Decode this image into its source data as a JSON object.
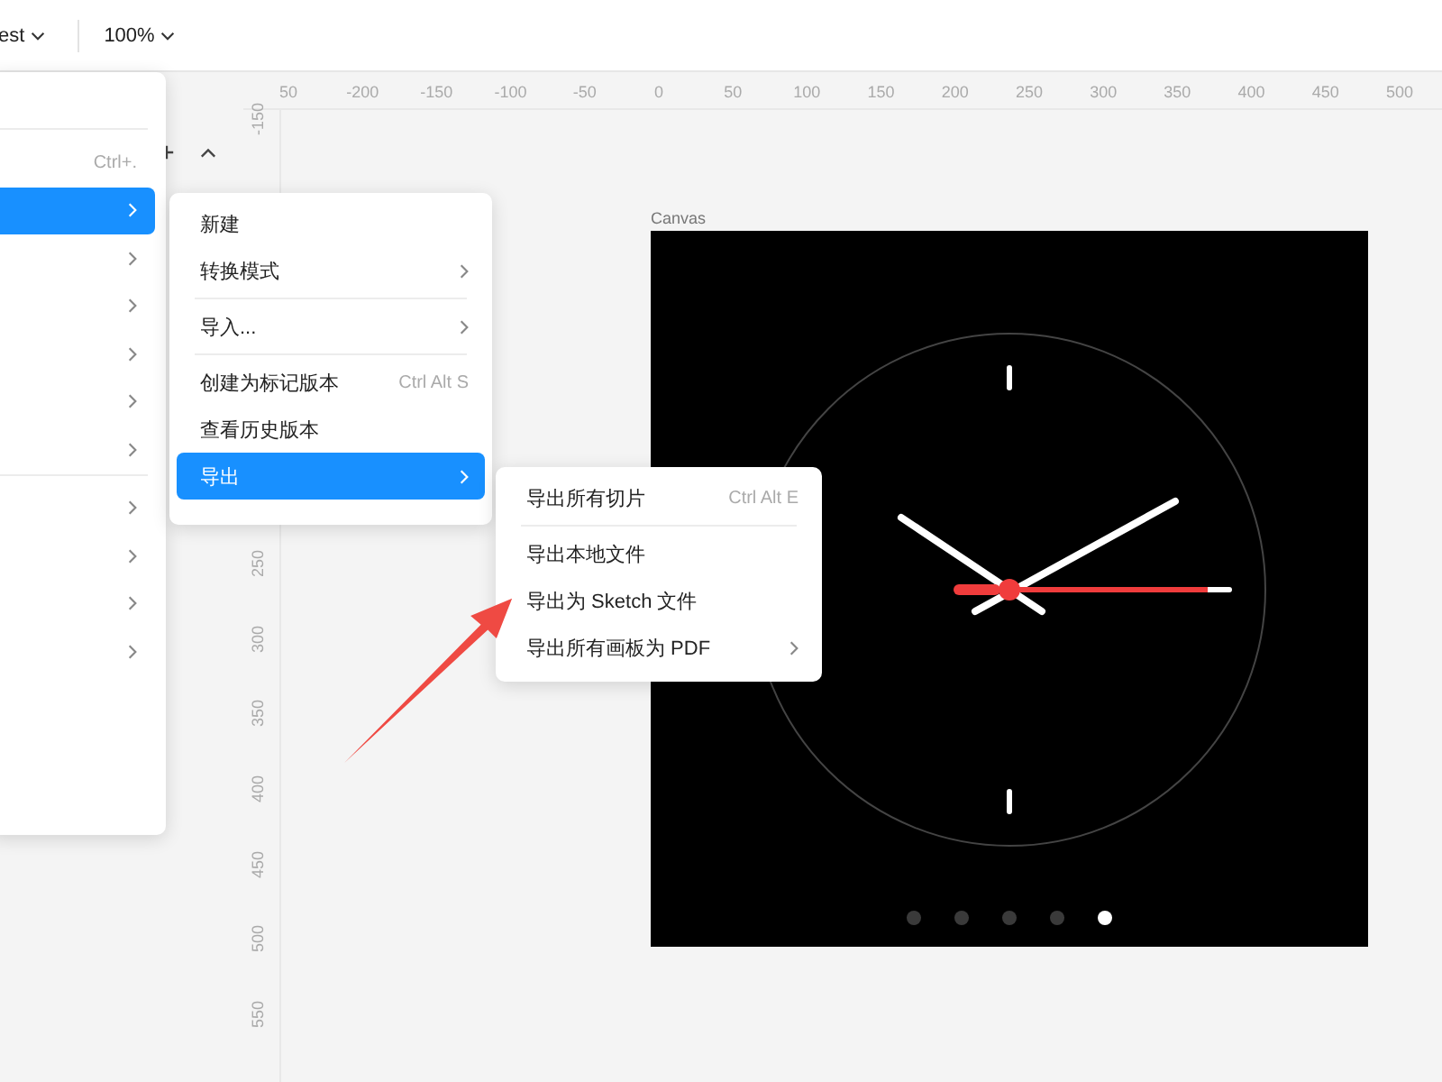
{
  "toolbar": {
    "file_name": "est",
    "zoom": "100%"
  },
  "ruler": {
    "horizontal": [
      "50",
      "-200",
      "-150",
      "-100",
      "-50",
      "0",
      "50",
      "100",
      "150",
      "200",
      "250",
      "300",
      "350",
      "400",
      "450",
      "500"
    ],
    "vertical": [
      "-150",
      "250",
      "300",
      "350",
      "400",
      "450",
      "500",
      "550"
    ]
  },
  "main_menu": {
    "items": [
      {
        "kind": "separator"
      },
      {
        "kind": "item",
        "shortcut": "Ctrl+.",
        "submenu": false,
        "selected": false
      },
      {
        "kind": "item",
        "submenu": true,
        "selected": true
      },
      {
        "kind": "item",
        "submenu": true,
        "selected": false
      },
      {
        "kind": "item",
        "submenu": true,
        "selected": false
      },
      {
        "kind": "item",
        "submenu": true,
        "selected": false
      },
      {
        "kind": "item",
        "submenu": true,
        "selected": false
      },
      {
        "kind": "item",
        "submenu": true,
        "selected": false
      },
      {
        "kind": "separator"
      },
      {
        "kind": "item",
        "submenu": true,
        "selected": false
      },
      {
        "kind": "item",
        "submenu": true,
        "selected": false
      },
      {
        "kind": "item",
        "submenu": true,
        "selected": false
      },
      {
        "kind": "item",
        "submenu": true,
        "selected": false
      }
    ]
  },
  "file_menu": {
    "items": [
      {
        "kind": "item",
        "label": "新建",
        "submenu": false,
        "selected": false
      },
      {
        "kind": "item",
        "label": "转换模式",
        "submenu": true,
        "selected": false
      },
      {
        "kind": "separator"
      },
      {
        "kind": "item",
        "label": "导入...",
        "submenu": true,
        "selected": false
      },
      {
        "kind": "separator"
      },
      {
        "kind": "item",
        "label": "创建为标记版本",
        "shortcut": "Ctrl Alt S",
        "submenu": false,
        "selected": false
      },
      {
        "kind": "item",
        "label": "查看历史版本",
        "submenu": false,
        "selected": false
      },
      {
        "kind": "item",
        "label": "导出",
        "submenu": true,
        "selected": true
      }
    ]
  },
  "export_menu": {
    "items": [
      {
        "kind": "item",
        "label": "导出所有切片",
        "shortcut": "Ctrl Alt E",
        "submenu": false,
        "selected": false
      },
      {
        "kind": "separator"
      },
      {
        "kind": "item",
        "label": "导出本地文件",
        "submenu": false,
        "selected": false
      },
      {
        "kind": "item",
        "label": "导出为 Sketch 文件",
        "submenu": false,
        "selected": false
      },
      {
        "kind": "item",
        "label": "导出所有画板为 PDF",
        "submenu": true,
        "selected": false
      }
    ]
  },
  "canvas": {
    "artboard_label": "Canvas",
    "pager": [
      {
        "selected": false
      },
      {
        "selected": false
      },
      {
        "selected": false
      },
      {
        "selected": false
      },
      {
        "selected": true
      }
    ]
  }
}
